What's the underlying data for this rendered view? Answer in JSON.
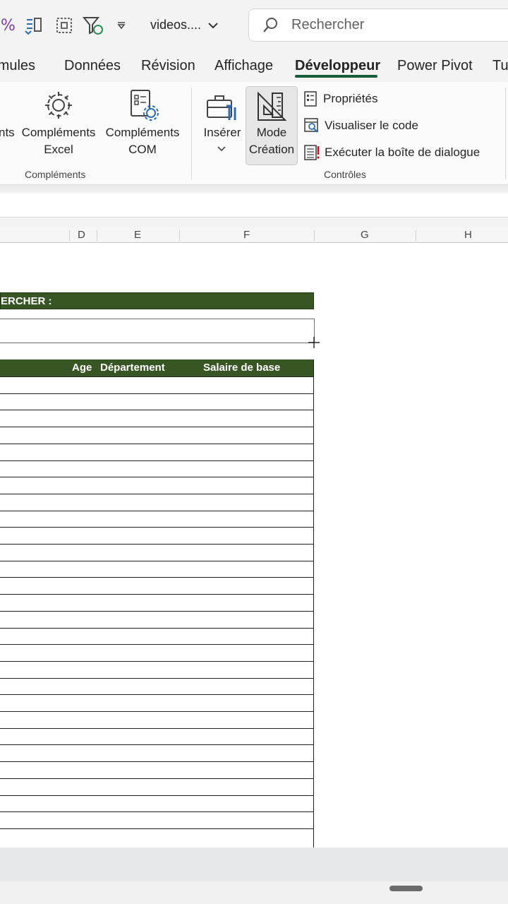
{
  "titlebar": {
    "filename": "videos....",
    "search_placeholder": "Rechercher",
    "icons": [
      "percent-icon",
      "compare-icon",
      "select-icon",
      "filter-refresh-icon",
      "customize-qat-icon"
    ]
  },
  "tabs": [
    {
      "label": "rmules"
    },
    {
      "label": "Données"
    },
    {
      "label": "Révision"
    },
    {
      "label": "Affichage"
    },
    {
      "label": "Développeur",
      "active": true
    },
    {
      "label": "Power Pivot"
    },
    {
      "label": "Tu"
    }
  ],
  "ribbon": {
    "nts_label": "nts",
    "excel_addins": {
      "line1": "Compléments",
      "line2": "Excel"
    },
    "com_addins": {
      "line1": "Compléments",
      "line2": "COM"
    },
    "addins_group": "Compléments",
    "insert": {
      "label": "Insérer"
    },
    "design_mode": {
      "line1": "Mode",
      "line2": "Création"
    },
    "properties": "Propriétés",
    "view_code": "Visualiser le code",
    "run_dialog": "Exécuter la boîte de dialogue",
    "controls_group": "Contrôles"
  },
  "columns": [
    "D",
    "E",
    "F",
    "G",
    "H"
  ],
  "sheet": {
    "search_header": "ERCHER :",
    "table_headers": {
      "age": "Age",
      "department": "Département",
      "salary": "Salaire de base"
    },
    "empty_rows": 28
  },
  "colors": {
    "accent": "#185c37",
    "header_green": "#375623"
  }
}
